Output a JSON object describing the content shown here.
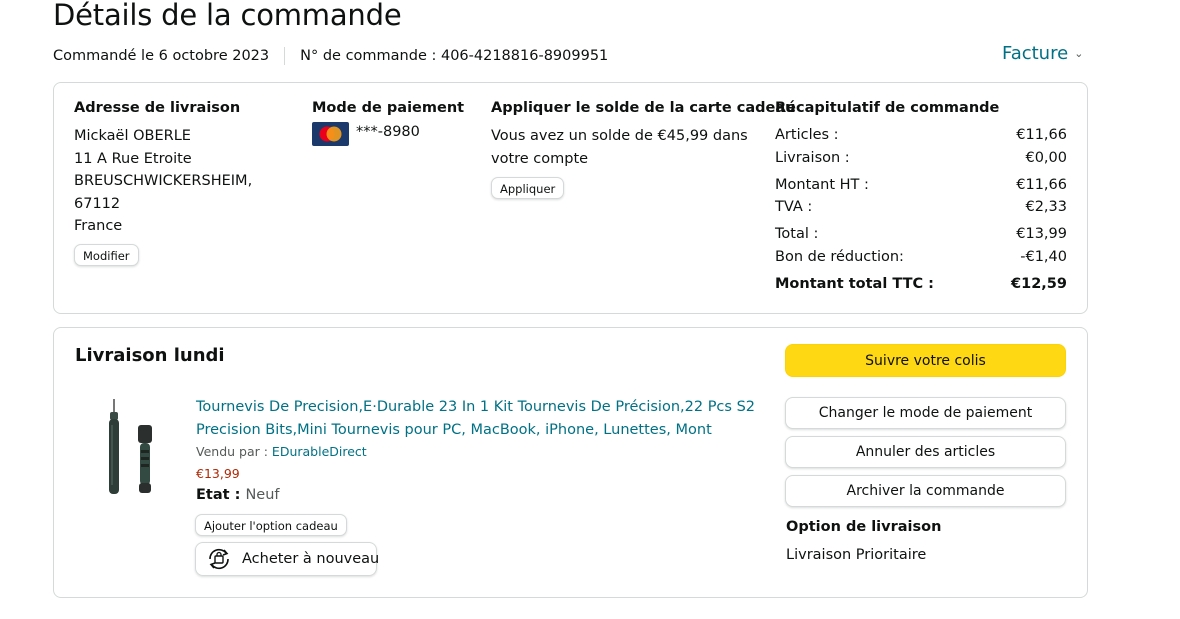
{
  "page": {
    "title": "Détails de la commande",
    "order_date": "Commandé le 6 octobre 2023",
    "order_number": "N° de commande : 406-4218816-8909951",
    "invoice_label": "Facture"
  },
  "shipping_address": {
    "header": "Adresse de livraison",
    "lines": [
      "Mickaël OBERLE",
      "11 A Rue Etroite",
      "BREUSCHWICKERSHEIM,",
      "67112",
      "France"
    ],
    "edit_button": "Modifier"
  },
  "payment": {
    "header": "Mode de paiement",
    "card_brand": "MasterCard",
    "card_number": "***-8980"
  },
  "gift_card": {
    "header": "Appliquer le solde de la carte cadeau",
    "text_line1": "Vous avez un solde de €45,99 dans",
    "text_line2": "votre compte",
    "apply_button": "Appliquer"
  },
  "summary": {
    "header": "Récapitulatif de commande",
    "rows": [
      {
        "label": "Articles :",
        "value": "€11,66"
      },
      {
        "label": "Livraison :",
        "value": "€0,00"
      },
      {
        "label": "Montant HT :",
        "value": "€11,66"
      },
      {
        "label": "TVA :",
        "value": "€2,33"
      },
      {
        "label": "Total :",
        "value": "€13,99"
      },
      {
        "label": "Bon de réduction:",
        "value": "-€1,40"
      },
      {
        "label": "Montant total TTC :",
        "value": "€12,59"
      }
    ]
  },
  "delivery": {
    "header": "Livraison lundi",
    "product": {
      "title_line1": "Tournevis De Precision,E·Durable 23 In 1 Kit Tournevis De Précision,22 Pcs S2",
      "title_line2": "Precision Bits,Mini Tournevis pour PC, MacBook, iPhone, Lunettes, Mont",
      "sold_by_label": "Vendu par : ",
      "seller": "EDurableDirect",
      "price": "€13,99",
      "condition_label": "Etat : ",
      "condition": "Neuf",
      "gift_button": "Ajouter l'option cadeau",
      "buy_again_button": "Acheter à nouveau"
    },
    "actions": {
      "track": "Suivre votre colis",
      "change_payment": "Changer le mode de paiement",
      "cancel_items": "Annuler des articles",
      "archive": "Archiver la commande"
    },
    "option_header": "Option de livraison",
    "option_value": "Livraison Prioritaire"
  },
  "colors": {
    "link": "#007185",
    "price": "#b12704",
    "primary_button": "#ffd814",
    "border": "#d5d9d9"
  }
}
